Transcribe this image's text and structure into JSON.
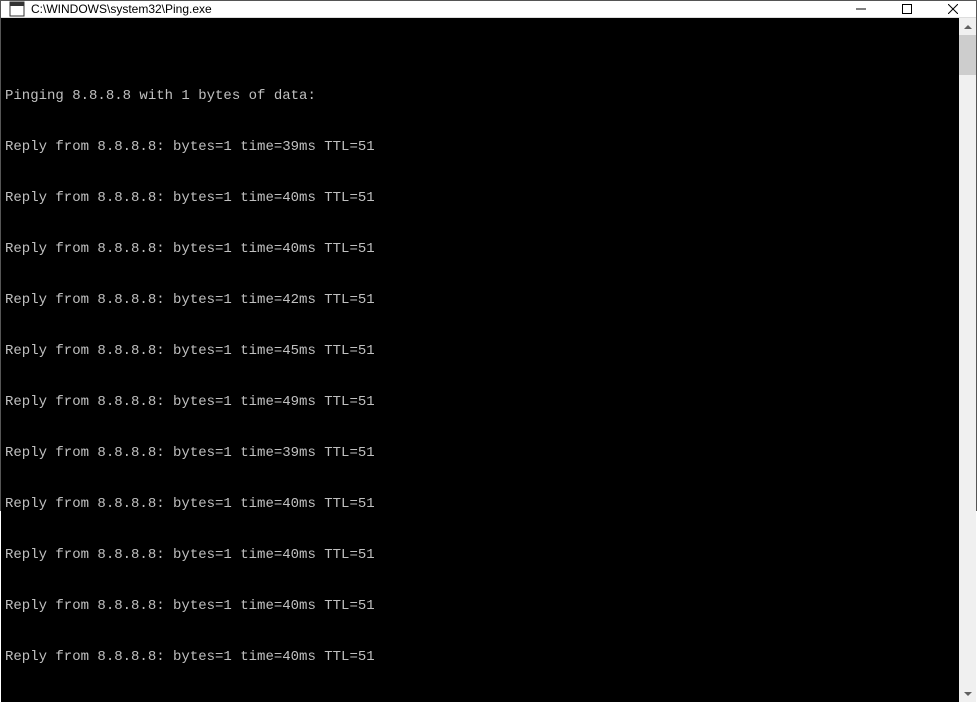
{
  "window": {
    "title": "C:\\WINDOWS\\system32\\Ping.exe"
  },
  "console": {
    "header_empty": "",
    "header": "Pinging 8.8.8.8 with 1 bytes of data:",
    "lines": [
      "Reply from 8.8.8.8: bytes=1 time=39ms TTL=51",
      "Reply from 8.8.8.8: bytes=1 time=40ms TTL=51",
      "Reply from 8.8.8.8: bytes=1 time=40ms TTL=51",
      "Reply from 8.8.8.8: bytes=1 time=42ms TTL=51",
      "Reply from 8.8.8.8: bytes=1 time=45ms TTL=51",
      "Reply from 8.8.8.8: bytes=1 time=49ms TTL=51",
      "Reply from 8.8.8.8: bytes=1 time=39ms TTL=51",
      "Reply from 8.8.8.8: bytes=1 time=40ms TTL=51",
      "Reply from 8.8.8.8: bytes=1 time=40ms TTL=51",
      "Reply from 8.8.8.8: bytes=1 time=40ms TTL=51",
      "Reply from 8.8.8.8: bytes=1 time=40ms TTL=51"
    ]
  }
}
